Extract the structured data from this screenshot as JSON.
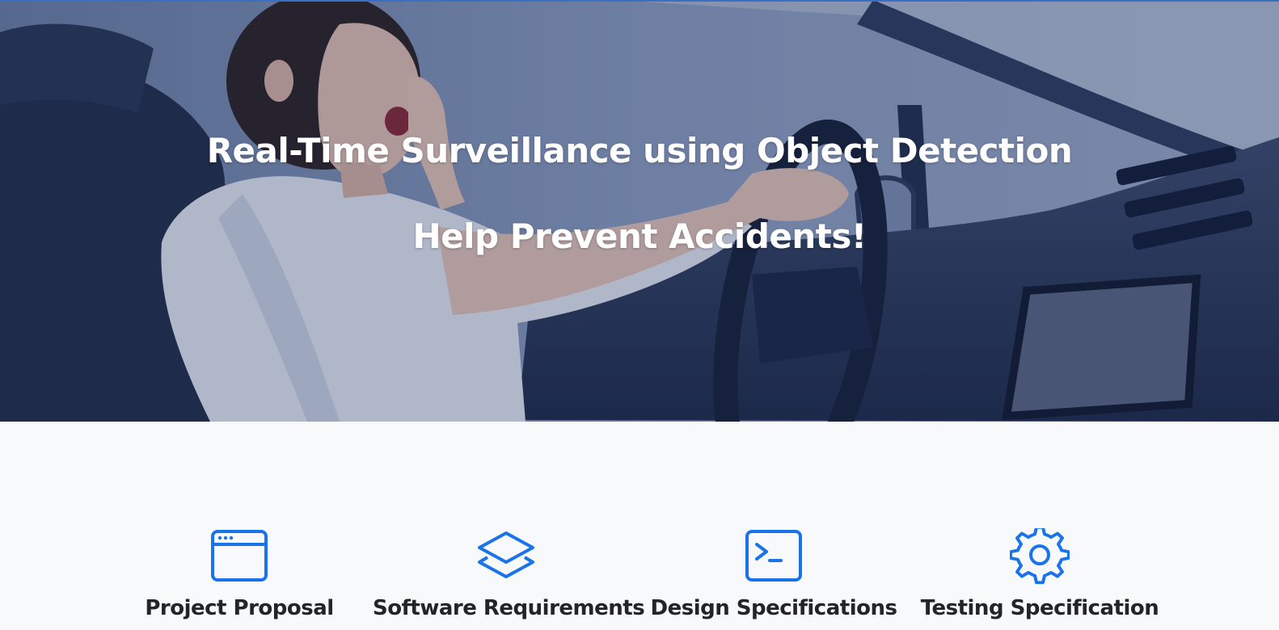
{
  "hero": {
    "title": "Real-Time Surveillance using Object Detection",
    "subtitle": "Help Prevent Accidents!",
    "background_image": "woman-yawning-while-driving-car"
  },
  "features": [
    {
      "label": "Project Proposal",
      "icon": "browser-window-icon"
    },
    {
      "label": "Software Requirements",
      "icon": "layers-icon"
    },
    {
      "label": "Design Specifications",
      "icon": "terminal-icon"
    },
    {
      "label": "Testing Specification",
      "icon": "gear-icon"
    }
  ],
  "colors": {
    "accent": "#1a73e8",
    "heading_text": "#212529",
    "section_bg": "#f8f9fa",
    "hero_text": "#ffffff"
  }
}
